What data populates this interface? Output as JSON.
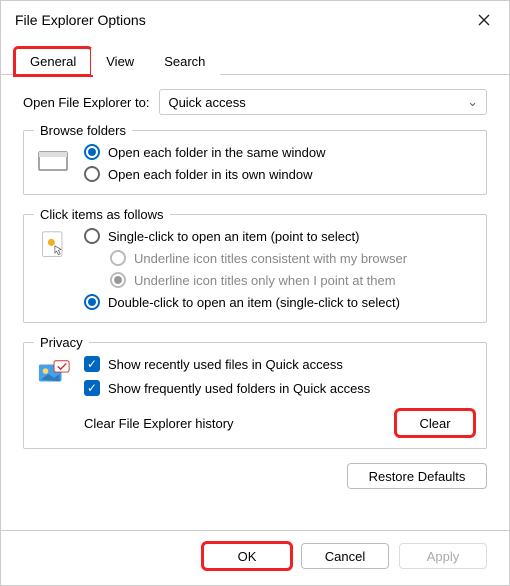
{
  "window": {
    "title": "File Explorer Options"
  },
  "tabs": {
    "general": "General",
    "view": "View",
    "search": "Search",
    "active": "general"
  },
  "open_in": {
    "label": "Open File Explorer to:",
    "value": "Quick access"
  },
  "browse": {
    "legend": "Browse folders",
    "same": "Open each folder in the same window",
    "own": "Open each folder in its own window"
  },
  "click": {
    "legend": "Click items as follows",
    "single": "Single-click to open an item (point to select)",
    "u_browser": "Underline icon titles consistent with my browser",
    "u_point": "Underline icon titles only when I point at them",
    "double": "Double-click to open an item (single-click to select)"
  },
  "privacy": {
    "legend": "Privacy",
    "recent_files": "Show recently used files in Quick access",
    "freq_folders": "Show frequently used folders in Quick access",
    "clear_label": "Clear File Explorer history",
    "clear_btn": "Clear"
  },
  "restore_defaults": "Restore Defaults",
  "footer": {
    "ok": "OK",
    "cancel": "Cancel",
    "apply": "Apply"
  }
}
